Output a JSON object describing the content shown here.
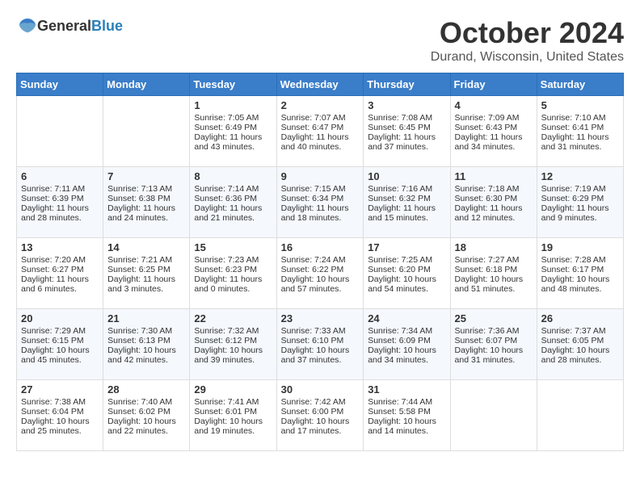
{
  "header": {
    "logo_general": "General",
    "logo_blue": "Blue",
    "title": "October 2024",
    "location": "Durand, Wisconsin, United States"
  },
  "days_of_week": [
    "Sunday",
    "Monday",
    "Tuesday",
    "Wednesday",
    "Thursday",
    "Friday",
    "Saturday"
  ],
  "weeks": [
    [
      {
        "day": "",
        "sunrise": "",
        "sunset": "",
        "daylight": ""
      },
      {
        "day": "",
        "sunrise": "",
        "sunset": "",
        "daylight": ""
      },
      {
        "day": "1",
        "sunrise": "Sunrise: 7:05 AM",
        "sunset": "Sunset: 6:49 PM",
        "daylight": "Daylight: 11 hours and 43 minutes."
      },
      {
        "day": "2",
        "sunrise": "Sunrise: 7:07 AM",
        "sunset": "Sunset: 6:47 PM",
        "daylight": "Daylight: 11 hours and 40 minutes."
      },
      {
        "day": "3",
        "sunrise": "Sunrise: 7:08 AM",
        "sunset": "Sunset: 6:45 PM",
        "daylight": "Daylight: 11 hours and 37 minutes."
      },
      {
        "day": "4",
        "sunrise": "Sunrise: 7:09 AM",
        "sunset": "Sunset: 6:43 PM",
        "daylight": "Daylight: 11 hours and 34 minutes."
      },
      {
        "day": "5",
        "sunrise": "Sunrise: 7:10 AM",
        "sunset": "Sunset: 6:41 PM",
        "daylight": "Daylight: 11 hours and 31 minutes."
      }
    ],
    [
      {
        "day": "6",
        "sunrise": "Sunrise: 7:11 AM",
        "sunset": "Sunset: 6:39 PM",
        "daylight": "Daylight: 11 hours and 28 minutes."
      },
      {
        "day": "7",
        "sunrise": "Sunrise: 7:13 AM",
        "sunset": "Sunset: 6:38 PM",
        "daylight": "Daylight: 11 hours and 24 minutes."
      },
      {
        "day": "8",
        "sunrise": "Sunrise: 7:14 AM",
        "sunset": "Sunset: 6:36 PM",
        "daylight": "Daylight: 11 hours and 21 minutes."
      },
      {
        "day": "9",
        "sunrise": "Sunrise: 7:15 AM",
        "sunset": "Sunset: 6:34 PM",
        "daylight": "Daylight: 11 hours and 18 minutes."
      },
      {
        "day": "10",
        "sunrise": "Sunrise: 7:16 AM",
        "sunset": "Sunset: 6:32 PM",
        "daylight": "Daylight: 11 hours and 15 minutes."
      },
      {
        "day": "11",
        "sunrise": "Sunrise: 7:18 AM",
        "sunset": "Sunset: 6:30 PM",
        "daylight": "Daylight: 11 hours and 12 minutes."
      },
      {
        "day": "12",
        "sunrise": "Sunrise: 7:19 AM",
        "sunset": "Sunset: 6:29 PM",
        "daylight": "Daylight: 11 hours and 9 minutes."
      }
    ],
    [
      {
        "day": "13",
        "sunrise": "Sunrise: 7:20 AM",
        "sunset": "Sunset: 6:27 PM",
        "daylight": "Daylight: 11 hours and 6 minutes."
      },
      {
        "day": "14",
        "sunrise": "Sunrise: 7:21 AM",
        "sunset": "Sunset: 6:25 PM",
        "daylight": "Daylight: 11 hours and 3 minutes."
      },
      {
        "day": "15",
        "sunrise": "Sunrise: 7:23 AM",
        "sunset": "Sunset: 6:23 PM",
        "daylight": "Daylight: 11 hours and 0 minutes."
      },
      {
        "day": "16",
        "sunrise": "Sunrise: 7:24 AM",
        "sunset": "Sunset: 6:22 PM",
        "daylight": "Daylight: 10 hours and 57 minutes."
      },
      {
        "day": "17",
        "sunrise": "Sunrise: 7:25 AM",
        "sunset": "Sunset: 6:20 PM",
        "daylight": "Daylight: 10 hours and 54 minutes."
      },
      {
        "day": "18",
        "sunrise": "Sunrise: 7:27 AM",
        "sunset": "Sunset: 6:18 PM",
        "daylight": "Daylight: 10 hours and 51 minutes."
      },
      {
        "day": "19",
        "sunrise": "Sunrise: 7:28 AM",
        "sunset": "Sunset: 6:17 PM",
        "daylight": "Daylight: 10 hours and 48 minutes."
      }
    ],
    [
      {
        "day": "20",
        "sunrise": "Sunrise: 7:29 AM",
        "sunset": "Sunset: 6:15 PM",
        "daylight": "Daylight: 10 hours and 45 minutes."
      },
      {
        "day": "21",
        "sunrise": "Sunrise: 7:30 AM",
        "sunset": "Sunset: 6:13 PM",
        "daylight": "Daylight: 10 hours and 42 minutes."
      },
      {
        "day": "22",
        "sunrise": "Sunrise: 7:32 AM",
        "sunset": "Sunset: 6:12 PM",
        "daylight": "Daylight: 10 hours and 39 minutes."
      },
      {
        "day": "23",
        "sunrise": "Sunrise: 7:33 AM",
        "sunset": "Sunset: 6:10 PM",
        "daylight": "Daylight: 10 hours and 37 minutes."
      },
      {
        "day": "24",
        "sunrise": "Sunrise: 7:34 AM",
        "sunset": "Sunset: 6:09 PM",
        "daylight": "Daylight: 10 hours and 34 minutes."
      },
      {
        "day": "25",
        "sunrise": "Sunrise: 7:36 AM",
        "sunset": "Sunset: 6:07 PM",
        "daylight": "Daylight: 10 hours and 31 minutes."
      },
      {
        "day": "26",
        "sunrise": "Sunrise: 7:37 AM",
        "sunset": "Sunset: 6:05 PM",
        "daylight": "Daylight: 10 hours and 28 minutes."
      }
    ],
    [
      {
        "day": "27",
        "sunrise": "Sunrise: 7:38 AM",
        "sunset": "Sunset: 6:04 PM",
        "daylight": "Daylight: 10 hours and 25 minutes."
      },
      {
        "day": "28",
        "sunrise": "Sunrise: 7:40 AM",
        "sunset": "Sunset: 6:02 PM",
        "daylight": "Daylight: 10 hours and 22 minutes."
      },
      {
        "day": "29",
        "sunrise": "Sunrise: 7:41 AM",
        "sunset": "Sunset: 6:01 PM",
        "daylight": "Daylight: 10 hours and 19 minutes."
      },
      {
        "day": "30",
        "sunrise": "Sunrise: 7:42 AM",
        "sunset": "Sunset: 6:00 PM",
        "daylight": "Daylight: 10 hours and 17 minutes."
      },
      {
        "day": "31",
        "sunrise": "Sunrise: 7:44 AM",
        "sunset": "Sunset: 5:58 PM",
        "daylight": "Daylight: 10 hours and 14 minutes."
      },
      {
        "day": "",
        "sunrise": "",
        "sunset": "",
        "daylight": ""
      },
      {
        "day": "",
        "sunrise": "",
        "sunset": "",
        "daylight": ""
      }
    ]
  ]
}
